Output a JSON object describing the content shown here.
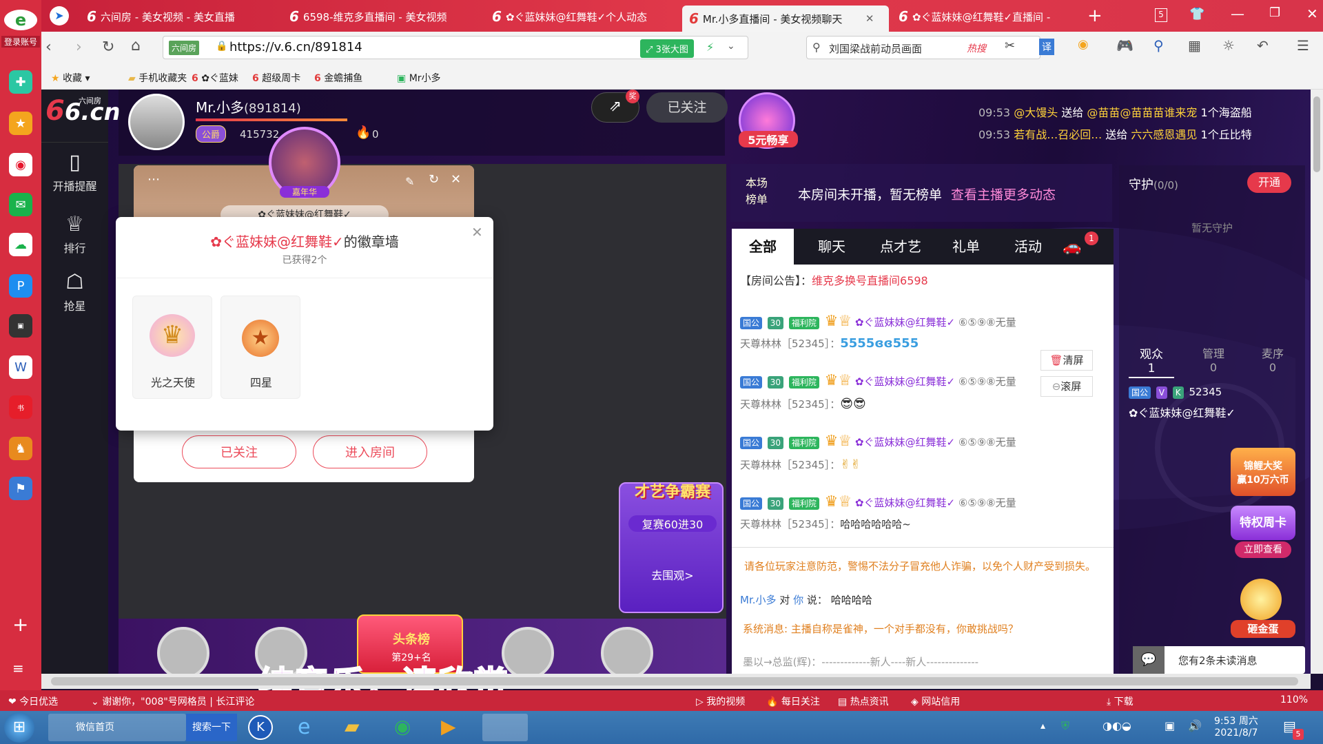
{
  "browser": {
    "tabs": [
      {
        "label": "六间房 - 美女视频 - 美女直播",
        "active": false
      },
      {
        "label": "6598-维克多直播间 - 美女视频",
        "active": false
      },
      {
        "label": "✿ぐ蓝妹妹@红舞鞋✓个人动态",
        "active": false
      },
      {
        "label": "Mr.小多直播间 - 美女视频聊天",
        "active": true
      },
      {
        "label": "✿ぐ蓝妹妹@红舞鞋✓直播间 -",
        "active": false
      }
    ],
    "tab_count": "5",
    "site_chip": "六间房",
    "url": "https://v.6.cn/891814",
    "bigimg_label": "3张大图",
    "search_placeholder": "刘国梁战前动员画面",
    "search_hot": "热搜",
    "translate_label": "译",
    "bookmarks": [
      "收藏",
      "手机收藏夹",
      "✿ぐ蓝妹",
      "超级周卡",
      "金蟾捕鱼",
      "Mr小多"
    ],
    "left_sidebar_top": "登录账号"
  },
  "page": {
    "logo_text": "6.cn",
    "logo_sub": "六间房",
    "nav": [
      {
        "label": "开播提醒",
        "icon": "phone-icon"
      },
      {
        "label": "排行",
        "icon": "crown-icon"
      },
      {
        "label": "抢星",
        "icon": "bag-icon"
      }
    ],
    "host": {
      "name": "Mr.小多",
      "room_id": "(891814)",
      "rank_badge": "公爵",
      "coins": "415732",
      "fire_count": "0",
      "follow_label": "已关注",
      "share_badge": "奖"
    },
    "promo_5yuan": "5元畅享",
    "gift_ticker": [
      {
        "time": "09:53",
        "from": "@大馒头",
        "verb": "送给",
        "to": "@苗苗@苗苗苗谁来宠",
        "gift": "1个海盗船"
      },
      {
        "time": "09:53",
        "from": "若有战…召必回…",
        "verb": "送给",
        "to": "六六感恩遇见",
        "gift": "1个丘比特"
      }
    ],
    "rank_tab": "本场\n榜单",
    "rank_empty": "本房间未开播，暂无榜单",
    "rank_link": "查看主播更多动态",
    "chat_tabs": [
      "全部",
      "聊天",
      "点才艺",
      "礼单",
      "活动"
    ],
    "chat_car_badge": "1",
    "announcement_label": "【房间公告】：",
    "announcement": "维克多换号直播间6598",
    "chat_messages": [
      {
        "badge1": "国公",
        "badge2": "30",
        "badge3": "福利院",
        "name": "✿ぐ蓝妹妹@红舞鞋✓",
        "tag": "⑥⑤⑨⑧无量",
        "user": "天尊林林［52345］：",
        "text": "5555ɞɞ555"
      },
      {
        "badge1": "国公",
        "badge2": "30",
        "badge3": "福利院",
        "name": "✿ぐ蓝妹妹@红舞鞋✓",
        "tag": "⑥⑤⑨⑧无量",
        "user": "天尊林林［52345］：",
        "text": "😎😎"
      },
      {
        "badge1": "国公",
        "badge2": "30",
        "badge3": "福利院",
        "name": "✿ぐ蓝妹妹@红舞鞋✓",
        "tag": "⑥⑤⑨⑧无量",
        "user": "天尊林林［52345］：",
        "text": "✌✌"
      },
      {
        "badge1": "国公",
        "badge2": "30",
        "badge3": "福利院",
        "name": "✿ぐ蓝妹妹@红舞鞋✓",
        "tag": "⑥⑤⑨⑧无量",
        "user": "天尊林林［52345］：",
        "text": "哈哈哈哈哈哈~"
      }
    ],
    "clear_screen": "清屏",
    "scroll_screen": "滚屏",
    "warning": "请各位玩家注意防范，警惕不法分子冒充他人诈骗，以免个人财产受到损失。",
    "private_msg": {
      "from": "Mr.小多",
      "to_label": "对",
      "you": "你",
      "say": "说：",
      "text": "哈哈哈哈"
    },
    "system_msg_label": "系统消息:",
    "system_msg": "主播自称是雀神，一个对手都没有，你敢挑战吗？",
    "last_msg_partial": "墨以→总监(辉)：-------------新人----新人--------------",
    "guard": {
      "title": "守护",
      "count": "(0/0)",
      "open_label": "开通",
      "empty": "暂无守护"
    },
    "audience_tabs": [
      {
        "label": "观众",
        "count": "1"
      },
      {
        "label": "管理",
        "count": "0"
      },
      {
        "label": "麦序",
        "count": "0"
      }
    ],
    "audience_user": {
      "badge": "国公",
      "v": "V",
      "k": "K",
      "id": "52345",
      "name": "✿ぐ蓝妹妹@红舞鞋✓"
    },
    "promo_right": [
      "锦鲤大奖\n赢10万六币",
      "特权周卡",
      "立即查看",
      "砸金蛋"
    ],
    "unread": "您有2条未读消息",
    "talent_title": "才艺争霸赛",
    "talent_sub": "复赛60进30",
    "talent_btn": "去围观>",
    "toutiao": "头条榜",
    "toutiao_rank": "第29+名",
    "subtitle": "纯音乐，请欣赏",
    "nianhua": "嘉年华"
  },
  "badge_popup": {
    "title_name": "✿ぐ蓝妹妹@红舞鞋✓",
    "title_suffix": "的徽章墙",
    "count": "已获得2个",
    "badges": [
      {
        "label": "光之天使",
        "icon": "angel-crown-icon"
      },
      {
        "label": "四星",
        "icon": "four-star-icon"
      }
    ]
  },
  "profile_card": {
    "follow": "已关注",
    "enter_room": "进入房间",
    "name_partial": "✿ぐ蓝妹妹@红舞鞋✓"
  },
  "statusbar": {
    "left": "今日优选",
    "news": "谢谢你，\"008\"号网格员 | 长江评论",
    "items": [
      "我的视频",
      "每日关注",
      "热点资讯",
      "网站信用",
      "下载"
    ],
    "zoom": "110%"
  },
  "taskbar": {
    "ie_title": "微信首页",
    "search_btn": "搜索一下",
    "time": "9:53 周六",
    "date": "2021/8/7",
    "notif_count": "5"
  },
  "colors": {
    "accent": "#e6394b",
    "chrome": "#d72d40",
    "panel": "#1b1a24"
  }
}
